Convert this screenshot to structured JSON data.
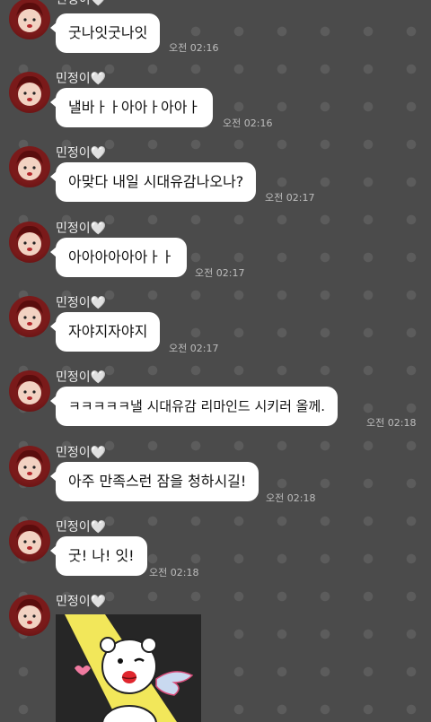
{
  "sender_name": "민정이🤍",
  "messages": [
    {
      "text": "굿나잇굿나잇",
      "time": "오전 02:16"
    },
    {
      "text": "낼바ㅏㅏ아아ㅏ아아ㅏ",
      "time": "오전 02:16"
    },
    {
      "text": "아맞다 내일 시대유감나오나?",
      "time": "오전 02:17"
    },
    {
      "text": "아아아아아아ㅏㅏ",
      "time": "오전 02:17"
    },
    {
      "text": "자야지자야지",
      "time": "오전 02:17"
    },
    {
      "text": "ㅋㅋㅋㅋㅋ낼 시대유감 리마인드 시키러 올께.",
      "time": "오전 02:18"
    },
    {
      "text": "아주 만족스런 잠을 청하시길!",
      "time": "오전 02:18"
    },
    {
      "text": "굿! 나! 잇!",
      "time": "오전 02:18"
    }
  ],
  "sticker_message": {
    "icon": "bear-sticker-icon"
  },
  "colors": {
    "background": "#4b4b4b",
    "bubble": "#ffffff",
    "time_text": "#bdbdbd"
  }
}
